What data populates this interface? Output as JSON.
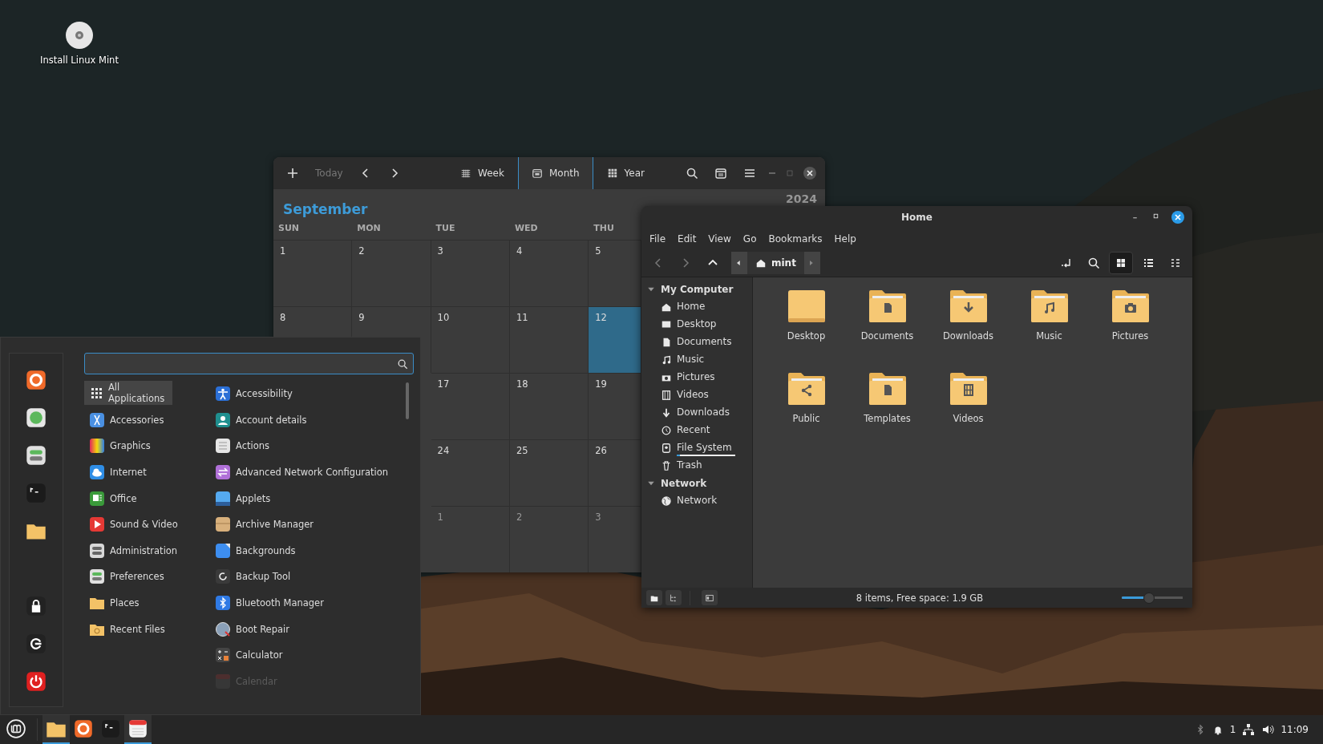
{
  "desktop": {
    "icons": [
      {
        "label": "Install Linux Mint"
      }
    ]
  },
  "calendar": {
    "today": {
      "label": "Today",
      "disabled": true
    },
    "views": [
      {
        "label": "Week",
        "selected": false
      },
      {
        "label": "Month",
        "selected": true
      },
      {
        "label": "Year",
        "selected": false
      }
    ],
    "month": "September",
    "year": "2024",
    "weekdays": [
      "SUN",
      "MON",
      "TUE",
      "WED",
      "THU"
    ],
    "weeks": [
      {
        "cells": [
          {
            "day": "1",
            "selected": false,
            "other_month": false
          },
          {
            "day": "2",
            "selected": false,
            "other_month": false
          },
          {
            "day": "3",
            "selected": false,
            "other_month": false
          },
          {
            "day": "4",
            "selected": false,
            "other_month": false
          },
          {
            "day": "5",
            "selected": false,
            "other_month": false
          }
        ]
      },
      {
        "cells": [
          {
            "day": "8",
            "selected": false,
            "other_month": false
          },
          {
            "day": "9",
            "selected": false,
            "other_month": false
          },
          {
            "day": "10",
            "selected": false,
            "other_month": false
          },
          {
            "day": "11",
            "selected": false,
            "other_month": false
          },
          {
            "day": "12",
            "selected": true,
            "other_month": false
          }
        ]
      },
      {
        "cells": [
          {
            "day": "17",
            "selected": false,
            "other_month": false
          },
          {
            "day": "18",
            "selected": false,
            "other_month": false
          },
          {
            "day": "19",
            "selected": false,
            "other_month": false
          }
        ]
      },
      {
        "cells": [
          {
            "day": "24",
            "selected": false,
            "other_month": false
          },
          {
            "day": "25",
            "selected": false,
            "other_month": false
          },
          {
            "day": "26",
            "selected": false,
            "other_month": false
          }
        ]
      },
      {
        "cells": [
          {
            "day": "1",
            "selected": false,
            "other_month": true
          },
          {
            "day": "2",
            "selected": false,
            "other_month": true
          },
          {
            "day": "3",
            "selected": false,
            "other_month": true
          }
        ]
      }
    ]
  },
  "file_manager": {
    "title": "Home",
    "menu": [
      "File",
      "Edit",
      "View",
      "Go",
      "Bookmarks",
      "Help"
    ],
    "path": "mint",
    "views": [
      {
        "kind": "grid",
        "selected": true
      },
      {
        "kind": "list",
        "selected": false
      },
      {
        "kind": "compact",
        "selected": false
      }
    ],
    "sidebar": [
      {
        "label": "My Computer",
        "expanded": true,
        "children": [
          {
            "label": "Home"
          },
          {
            "label": "Desktop"
          },
          {
            "label": "Documents"
          },
          {
            "label": "Music"
          },
          {
            "label": "Pictures"
          },
          {
            "label": "Videos"
          },
          {
            "label": "Downloads"
          },
          {
            "label": "Recent"
          },
          {
            "label": "File System",
            "level": 0.05
          },
          {
            "label": "Trash"
          }
        ]
      },
      {
        "label": "Network",
        "expanded": true,
        "children": [
          {
            "label": "Network"
          }
        ]
      }
    ],
    "items": [
      {
        "label": "Desktop"
      },
      {
        "label": "Documents"
      },
      {
        "label": "Downloads"
      },
      {
        "label": "Music"
      },
      {
        "label": "Pictures"
      },
      {
        "label": "Public"
      },
      {
        "label": "Templates"
      },
      {
        "label": "Videos"
      }
    ],
    "status": "8 items, Free space: 1.9 GB",
    "zoom": {
      "level": 0.45
    }
  },
  "menu": {
    "categories": [
      {
        "label": "All Applications",
        "selected": true
      },
      {
        "label": "Accessories",
        "selected": false
      },
      {
        "label": "Graphics",
        "selected": false
      },
      {
        "label": "Internet",
        "selected": false
      },
      {
        "label": "Office",
        "selected": false
      },
      {
        "label": "Sound & Video",
        "selected": false
      },
      {
        "label": "Administration",
        "selected": false
      },
      {
        "label": "Preferences",
        "selected": false
      },
      {
        "label": "Places",
        "selected": false
      },
      {
        "label": "Recent Files",
        "selected": false
      }
    ],
    "apps": [
      {
        "label": "Accessibility",
        "faded": false
      },
      {
        "label": "Account details",
        "faded": false
      },
      {
        "label": "Actions",
        "faded": false
      },
      {
        "label": "Advanced Network Configuration",
        "faded": false
      },
      {
        "label": "Applets",
        "faded": false
      },
      {
        "label": "Archive Manager",
        "faded": false
      },
      {
        "label": "Backgrounds",
        "faded": false
      },
      {
        "label": "Backup Tool",
        "faded": false
      },
      {
        "label": "Bluetooth Manager",
        "faded": false
      },
      {
        "label": "Boot Repair",
        "faded": false
      },
      {
        "label": "Calculator",
        "faded": false
      },
      {
        "label": "Calendar",
        "faded": true
      }
    ]
  },
  "taskbar": {
    "launchers": [
      {
        "active": true
      },
      {
        "active": false
      },
      {
        "active": false
      },
      {
        "active": true
      }
    ],
    "notifications": "1",
    "clock": "11:09"
  }
}
